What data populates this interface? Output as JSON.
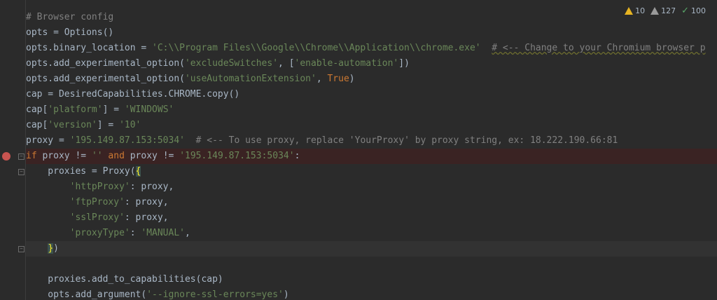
{
  "inspections": {
    "warnings_count": "10",
    "weak_warnings_count": "127",
    "ok_count": "100"
  },
  "code": {
    "l1": "# Browser config",
    "l2": "opts = Options()",
    "l3a": "opts.binary_location = ",
    "l3b": "'C:\\\\Program Files\\\\Google\\\\Chrome\\\\Application\\\\chrome.exe'",
    "l3c": "  ",
    "l3d": "# <-- Change to your Chromium browser p",
    "l4a": "opts.add_experimental_option(",
    "l4b": "'excludeSwitches'",
    "l4c": ", [",
    "l4d": "'enable-automation'",
    "l4e": "])",
    "l5a": "opts.add_experimental_option(",
    "l5b": "'useAutomationExtension'",
    "l5c": ", ",
    "l5d": "True",
    "l5e": ")",
    "l6": "cap = DesiredCapabilities.CHROME.copy()",
    "l7a": "cap[",
    "l7b": "'platform'",
    "l7c": "] = ",
    "l7d": "'WINDOWS'",
    "l8a": "cap[",
    "l8b": "'version'",
    "l8c": "] = ",
    "l8d": "'10'",
    "l9a": "proxy = ",
    "l9b": "'195.149.87.153:5034'",
    "l9c": "  # <-- To use proxy, replace 'YourProxy' by proxy string, ex: 18.222.190.66:81",
    "l10a": "if",
    "l10b": " proxy != ",
    "l10c": "''",
    "l10d": " and",
    "l10e": " proxy != ",
    "l10f": "'195.149.87.153:5034'",
    "l10g": ":",
    "l11a": "    proxies = Proxy(",
    "l11b": "{",
    "l12a": "        ",
    "l12b": "'httpProxy'",
    "l12c": ": proxy,",
    "l13b": "'ftpProxy'",
    "l13c": ": proxy,",
    "l14b": "'sslProxy'",
    "l14c": ": proxy,",
    "l15b": "'proxyType'",
    "l15c": ": ",
    "l15d": "'MANUAL'",
    "l15e": ",",
    "l16a": "    ",
    "l16b": "}",
    "l16c": ")",
    "l18": "    proxies.add_to_capabilities(cap)",
    "l19a": "    opts.add_argument(",
    "l19b": "'--ignore-ssl-errors=yes'",
    "l19c": ")"
  },
  "colors": {
    "background": "#2b2b2b",
    "keyword": "#cc7832",
    "string": "#6a8759",
    "comment": "#808080",
    "breakpoint": "#c75450"
  }
}
